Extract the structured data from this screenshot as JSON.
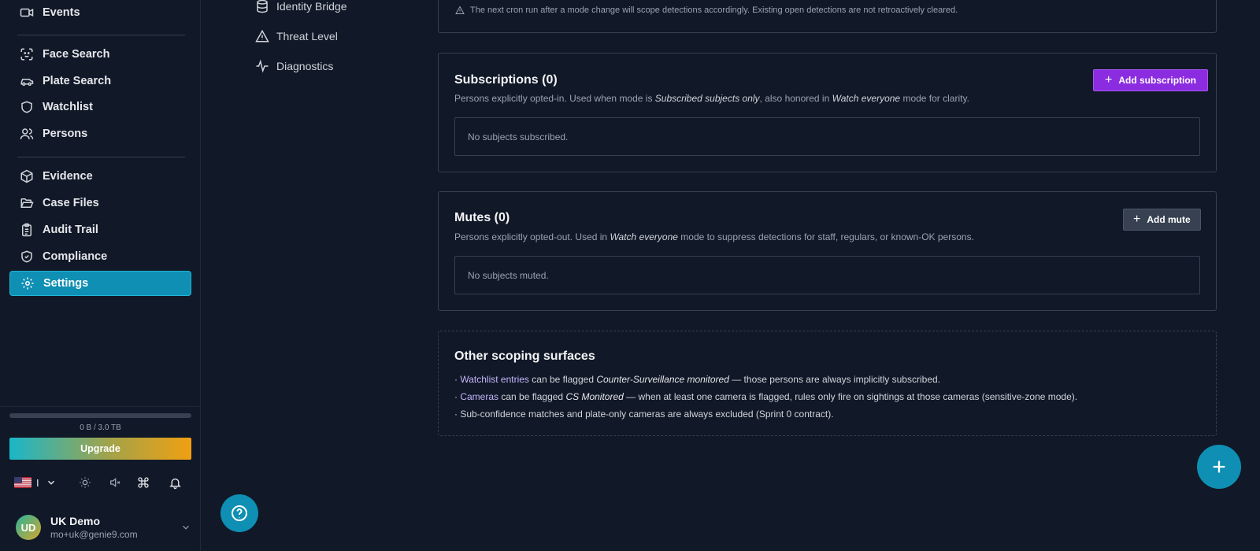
{
  "sidebar": {
    "items": [
      {
        "label": "Events",
        "icon": "video-icon"
      },
      {
        "label": "Face Search",
        "icon": "face-scan-icon"
      },
      {
        "label": "Plate Search",
        "icon": "car-icon"
      },
      {
        "label": "Watchlist",
        "icon": "shield-icon"
      },
      {
        "label": "Persons",
        "icon": "users-icon"
      },
      {
        "label": "Evidence",
        "icon": "box-icon"
      },
      {
        "label": "Case Files",
        "icon": "folder-open-icon"
      },
      {
        "label": "Audit Trail",
        "icon": "clipboard-list-icon"
      },
      {
        "label": "Compliance",
        "icon": "shield-check-icon"
      },
      {
        "label": "Settings",
        "icon": "gear-icon",
        "active": true
      }
    ],
    "storage": {
      "text": "0 B / 3.0 TB",
      "used_fraction": 0
    },
    "upgrade_label": "Upgrade",
    "language": "I",
    "user": {
      "initials": "UD",
      "name": "UK Demo",
      "email": "mo+uk@genie9.com"
    }
  },
  "settings_nav": [
    {
      "label": "Identity Bridge",
      "icon": "database-icon"
    },
    {
      "label": "Threat Level",
      "icon": "warning-triangle-icon"
    },
    {
      "label": "Diagnostics",
      "icon": "activity-icon"
    }
  ],
  "main": {
    "mode_note": "The next cron run after a mode change will scope detections accordingly. Existing open detections are not retroactively cleared.",
    "subscriptions": {
      "title": "Subscriptions (0)",
      "desc_1": "Persons explicitly opted-in. Used when mode is ",
      "desc_em_1": "Subscribed subjects only",
      "desc_2": ", also honored in ",
      "desc_em_2": "Watch everyone",
      "desc_3": " mode for clarity.",
      "button": "Add subscription",
      "empty": "No subjects subscribed."
    },
    "mutes": {
      "title": "Mutes (0)",
      "desc_1": "Persons explicitly opted-out. Used in ",
      "desc_em_1": "Watch everyone",
      "desc_2": " mode to suppress detections for staff, regulars, or known-OK persons.",
      "button": "Add mute",
      "empty": "No subjects muted."
    },
    "other": {
      "title": "Other scoping surfaces",
      "line1": {
        "prefix": "· ",
        "link": "Watchlist entries",
        "mid": " can be flagged ",
        "em": "Counter-Surveillance monitored",
        "rest": " — those persons are always implicitly subscribed."
      },
      "line2": {
        "prefix": "· ",
        "link": "Cameras",
        "mid": " can be flagged ",
        "em": "CS Monitored",
        "rest": " — when at least one camera is flagged, rules only fire on sightings at those cameras (sensitive-zone mode)."
      },
      "line3": {
        "text": "· Sub-confidence matches and plate-only cameras are always excluded (Sprint 0 contract)."
      }
    }
  },
  "colors": {
    "accent": "#0e8fb3",
    "primary_button": "#8b2ce0",
    "background": "#111827"
  }
}
